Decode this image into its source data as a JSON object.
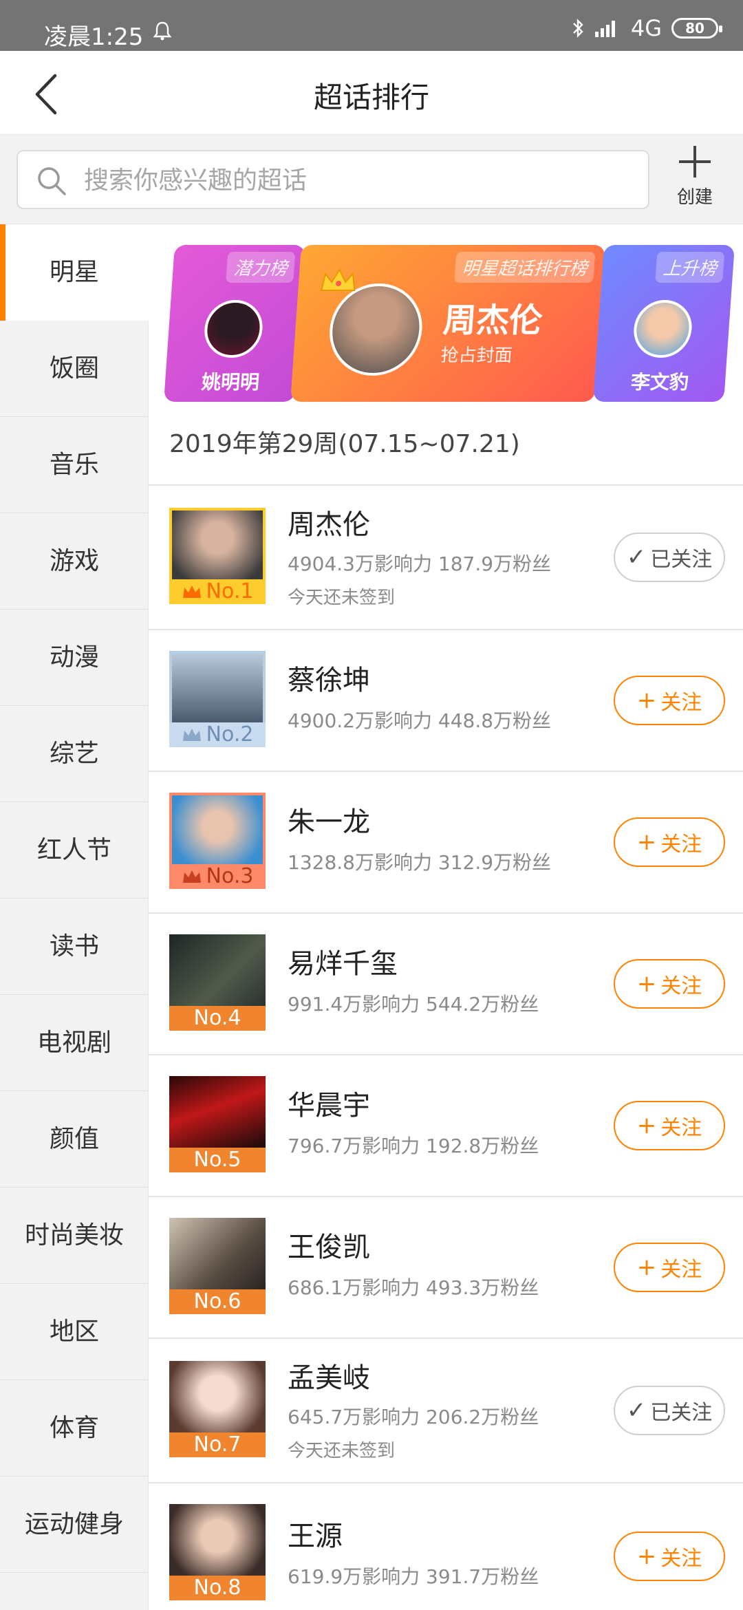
{
  "status": {
    "time": "凌晨1:25",
    "network": "4G",
    "battery": "80"
  },
  "header": {
    "title": "超话排行"
  },
  "search": {
    "placeholder": "搜索你感兴趣的超话",
    "create_label": "创建"
  },
  "sidebar": {
    "items": [
      {
        "label": "明星",
        "active": true
      },
      {
        "label": "饭圈"
      },
      {
        "label": "音乐"
      },
      {
        "label": "游戏"
      },
      {
        "label": "动漫"
      },
      {
        "label": "综艺"
      },
      {
        "label": "红人节"
      },
      {
        "label": "读书"
      },
      {
        "label": "电视剧"
      },
      {
        "label": "颜值"
      },
      {
        "label": "时尚美妆"
      },
      {
        "label": "地区"
      },
      {
        "label": "体育"
      },
      {
        "label": "运动健身"
      }
    ]
  },
  "banner": {
    "left": {
      "tag": "潜力榜",
      "name": "姚明明"
    },
    "mid": {
      "tag": "明星超话排行榜",
      "name": "周杰伦",
      "sub": "抢占封面"
    },
    "right": {
      "tag": "上升榜",
      "name": "李文豹"
    }
  },
  "week_label": "2019年第29周(07.15~07.21)",
  "follow_label": "关注",
  "followed_label": "已关注",
  "rankings": [
    {
      "rank": "No.1",
      "name": "周杰伦",
      "stats": "4904.3万影响力 187.9万粉丝",
      "sign": "今天还未签到",
      "followed": true
    },
    {
      "rank": "No.2",
      "name": "蔡徐坤",
      "stats": "4900.2万影响力 448.8万粉丝",
      "followed": false
    },
    {
      "rank": "No.3",
      "name": "朱一龙",
      "stats": "1328.8万影响力 312.9万粉丝",
      "followed": false
    },
    {
      "rank": "No.4",
      "name": "易烊千玺",
      "stats": "991.4万影响力 544.2万粉丝",
      "followed": false
    },
    {
      "rank": "No.5",
      "name": "华晨宇",
      "stats": "796.7万影响力 192.8万粉丝",
      "followed": false
    },
    {
      "rank": "No.6",
      "name": "王俊凯",
      "stats": "686.1万影响力 493.3万粉丝",
      "followed": false
    },
    {
      "rank": "No.7",
      "name": "孟美岐",
      "stats": "645.7万影响力 206.2万粉丝",
      "sign": "今天还未签到",
      "followed": true
    },
    {
      "rank": "No.8",
      "name": "王源",
      "stats": "619.9万影响力 391.7万粉丝",
      "followed": false
    }
  ],
  "colors": {
    "accent": "#ff8200",
    "rank1": "#ffcc2e",
    "rank2": "#b7cfe6",
    "rank3": "#ff8a6a",
    "rank_other": "#f0852e"
  }
}
